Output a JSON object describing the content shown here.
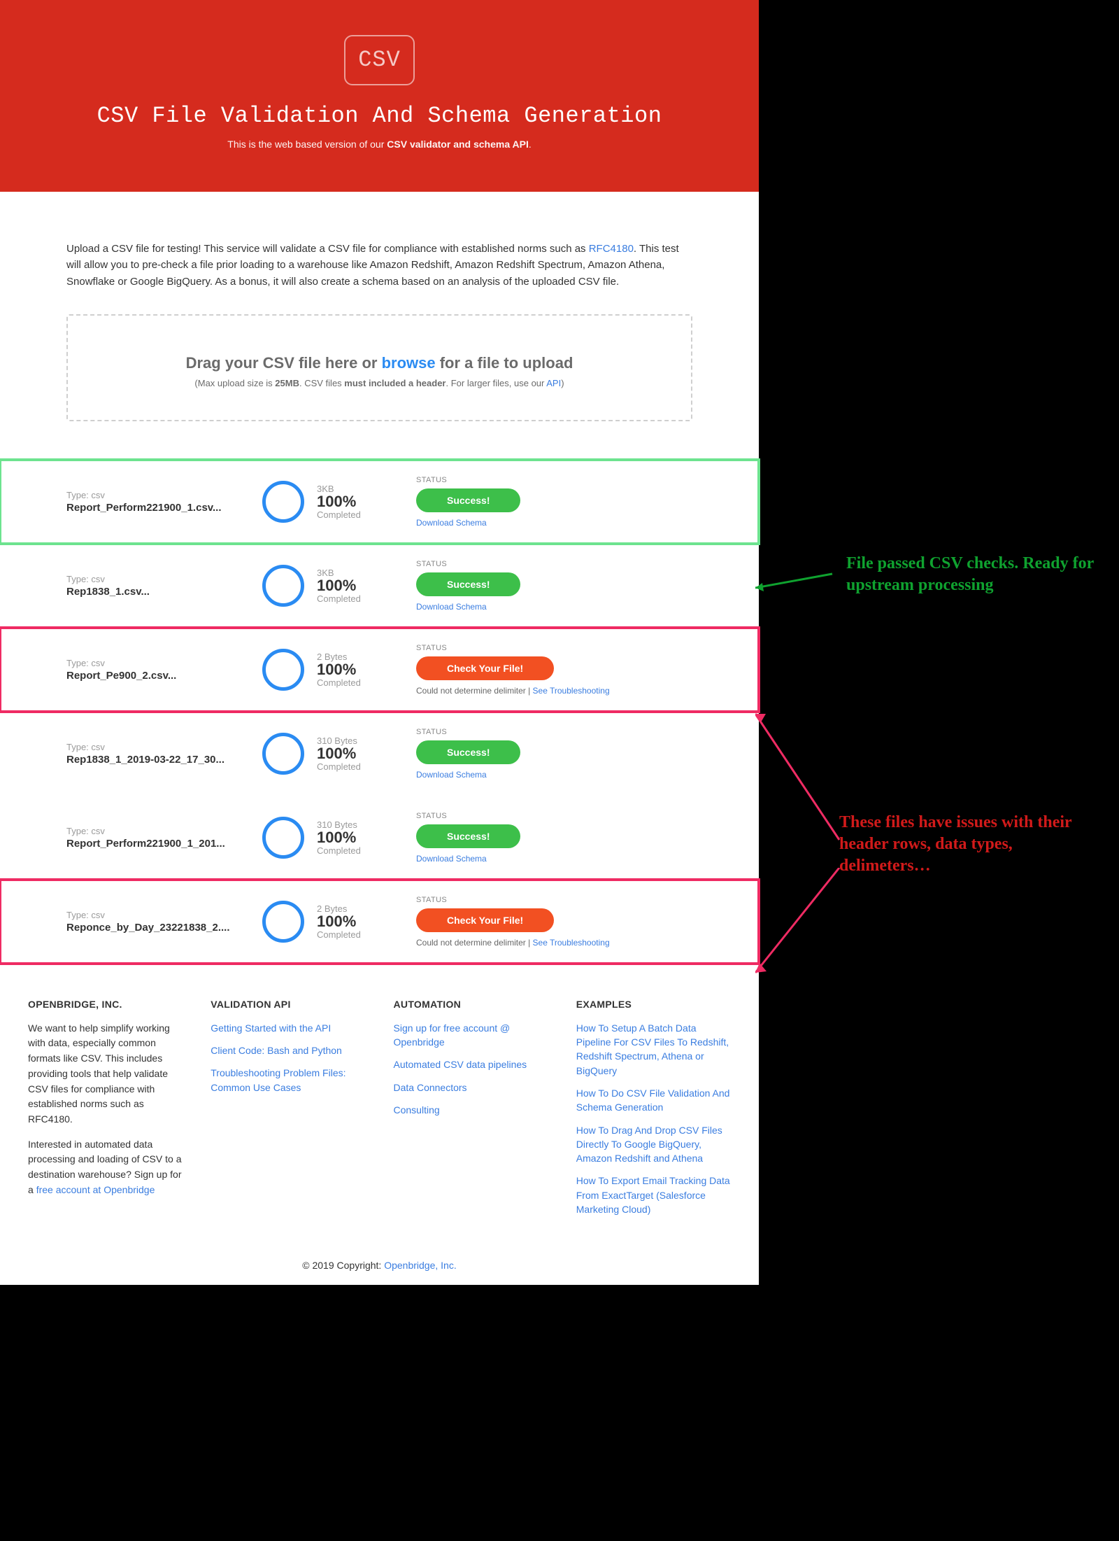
{
  "hero": {
    "icon_label": "CSV",
    "title": "CSV File Validation And Schema Generation",
    "subtitle_a": "This is the web based version of our ",
    "subtitle_b": "CSV validator and schema API",
    "subtitle_c": "."
  },
  "intro": {
    "a": "Upload a CSV file for testing! This service will validate a CSV file for compliance with established norms such as ",
    "rfc_link": "RFC4180",
    "b": ". This test will allow you to pre-check a file prior loading to a warehouse like Amazon Redshift, Amazon Redshift Spectrum, Amazon Athena, Snowflake or Google BigQuery. As a bonus, it will also create a schema based on an analysis of the uploaded CSV file."
  },
  "dropzone": {
    "title_a": "Drag your CSV file here or ",
    "browse": "browse",
    "title_b": " for a file to upload",
    "sub_a": "(Max upload size is ",
    "sub_b": "25MB",
    "sub_c": ". CSV files ",
    "sub_d": "must included a header",
    "sub_e": ". For larger files, use our ",
    "api_link": "API",
    "sub_f": ")"
  },
  "status_label": "STATUS",
  "completed_label": "Completed",
  "type_prefix": "Type: ",
  "download_schema": "Download Schema",
  "error_msg_a": "Could not determine delimiter | ",
  "see_trouble": "See Troubleshooting",
  "files": [
    {
      "type": "csv",
      "name": "Report_Perform221900_1.csv...",
      "size": "3KB",
      "pct": "100%",
      "status": "Success!",
      "kind": "success",
      "highlight": "green"
    },
    {
      "type": "csv",
      "name": "Rep1838_1.csv...",
      "size": "3KB",
      "pct": "100%",
      "status": "Success!",
      "kind": "success",
      "highlight": "none"
    },
    {
      "type": "csv",
      "name": "Report_Pe900_2.csv...",
      "size": "2 Bytes",
      "pct": "100%",
      "status": "Check Your File!",
      "kind": "error",
      "highlight": "red"
    },
    {
      "type": "csv",
      "name": "Rep1838_1_2019-03-22_17_30...",
      "size": "310 Bytes",
      "pct": "100%",
      "status": "Success!",
      "kind": "success",
      "highlight": "none"
    },
    {
      "type": "csv",
      "name": "Report_Perform221900_1_201...",
      "size": "310 Bytes",
      "pct": "100%",
      "status": "Success!",
      "kind": "success",
      "highlight": "none"
    },
    {
      "type": "csv",
      "name": "Reponce_by_Day_23221838_2....",
      "size": "2 Bytes",
      "pct": "100%",
      "status": "Check Your File!",
      "kind": "error",
      "highlight": "red"
    }
  ],
  "footer": {
    "col1": {
      "heading": "OPENBRIDGE, INC.",
      "p1": "We want to help simplify working with data, especially common formats like CSV. This includes providing tools that help validate CSV files for compliance with established norms such as RFC4180.",
      "p2a": "Interested in automated data processing and loading of CSV to a destination warehouse? Sign up for a ",
      "p2_link": "free account at Openbridge"
    },
    "col2": {
      "heading": "VALIDATION API",
      "links": [
        "Getting Started with the API",
        "Client Code: Bash and Python",
        "Troubleshooting Problem Files: Common Use Cases"
      ]
    },
    "col3": {
      "heading": "AUTOMATION",
      "links": [
        "Sign up for free account @ Openbridge",
        "Automated CSV data pipelines",
        "Data Connectors",
        "Consulting"
      ]
    },
    "col4": {
      "heading": "EXAMPLES",
      "links": [
        "How To Setup A Batch Data Pipeline For CSV Files To Redshift, Redshift Spectrum, Athena or BigQuery",
        "How To Do CSV File Validation And Schema Generation",
        "How To Drag And Drop CSV Files Directly To Google BigQuery, Amazon Redshift and Athena",
        "How To Export Email Tracking Data From ExactTarget (Salesforce Marketing Cloud)"
      ]
    }
  },
  "copyright": {
    "a": "© 2019 Copyright: ",
    "link": "Openbridge, Inc."
  },
  "annotations": {
    "green": "File passed CSV checks. Ready for upstream processing",
    "red": "These files have issues with their header rows, data types, delimeters…"
  }
}
